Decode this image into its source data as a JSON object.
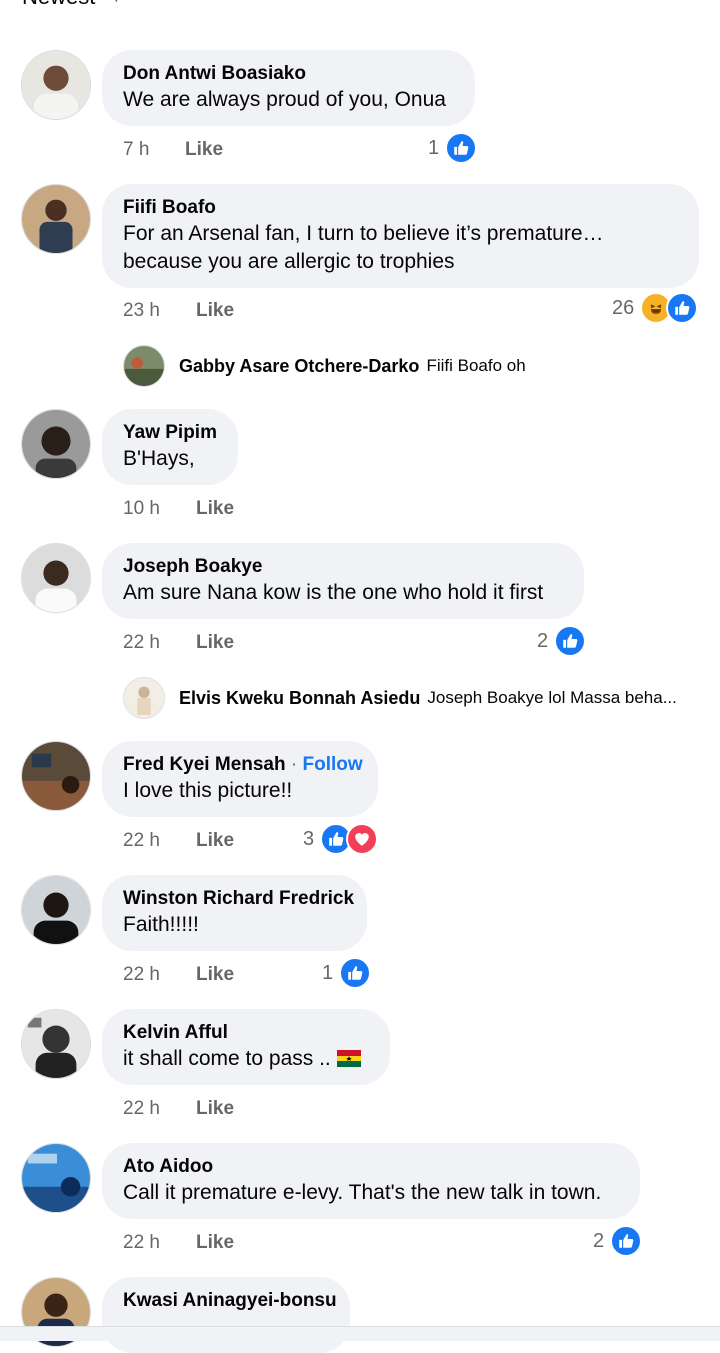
{
  "header": {
    "sort_label": "Newest"
  },
  "comments": [
    {
      "author": "Don Antwi Boasiako",
      "text": "We are always proud of you, Onua",
      "time": "7 h",
      "like_label": "Like",
      "reaction_count": "1",
      "reactions": [
        "like"
      ]
    },
    {
      "author": "Fiifi Boafo",
      "text_line1": "For an Arsenal fan, I turn to believe it’s premature…",
      "text_line2": "because you are allergic to trophies",
      "time": "23 h",
      "like_label": "Like",
      "reaction_count": "26",
      "reactions": [
        "haha",
        "like"
      ],
      "reply": {
        "author": "Gabby Asare Otchere-Darko",
        "text": "Fiifi Boafo oh"
      }
    },
    {
      "author": "Yaw Pipim",
      "text": "B'Hays,",
      "time": "10 h",
      "like_label": "Like"
    },
    {
      "author": "Joseph Boakye",
      "text": "Am sure Nana kow is the one who hold it first",
      "time": "22 h",
      "like_label": "Like",
      "reaction_count": "2",
      "reactions": [
        "like"
      ],
      "reply": {
        "author": "Elvis Kweku Bonnah Asiedu",
        "text": "Joseph Boakye lol Massa beha..."
      }
    },
    {
      "author": "Fred Kyei Mensah",
      "separator": "·",
      "follow_label": "Follow",
      "text": "I love this picture!!",
      "time": "22 h",
      "like_label": "Like",
      "reaction_count": "3",
      "reactions": [
        "like",
        "love"
      ]
    },
    {
      "author": "Winston Richard Fredrick",
      "text": "Faith!!!!!",
      "time": "22 h",
      "like_label": "Like",
      "reaction_count": "1",
      "reactions": [
        "like"
      ]
    },
    {
      "author": "Kelvin Afful",
      "text": "it shall come to pass ..",
      "flag": "ghana-flag-icon",
      "time": "22 h",
      "like_label": "Like"
    },
    {
      "author": "Ato Aidoo",
      "text": "Call it premature e-levy. That's the new talk in town.",
      "time": "22 h",
      "like_label": "Like",
      "reaction_count": "2",
      "reactions": [
        "like"
      ]
    },
    {
      "author": "Kwasi Aninagyei-bonsu"
    }
  ],
  "colors": {
    "bubble": "#f0f2f5",
    "like_blue": "#1877f2",
    "love_red": "#f33e58",
    "haha_yellow": "#f7b125",
    "meta_gray": "#65676b"
  },
  "icons": {
    "like": "thumbs-up-icon",
    "love": "heart-icon",
    "haha": "laughing-face-icon",
    "sort": "chevron-down-icon"
  }
}
